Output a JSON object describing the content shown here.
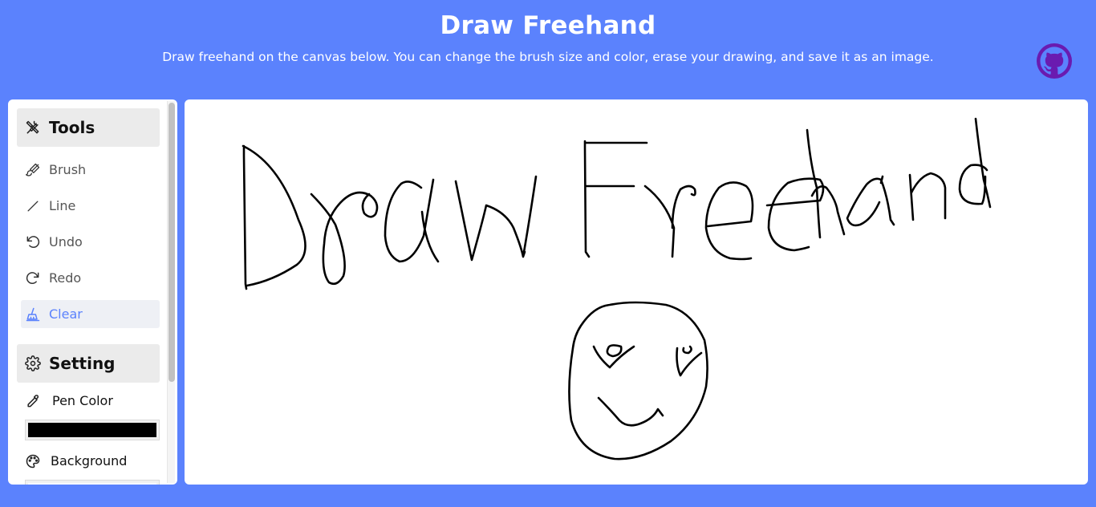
{
  "header": {
    "title": "Draw Freehand",
    "subtitle": "Draw freehand on the canvas below. You can change the brush size and color, erase your drawing, and save it as an image."
  },
  "github": {
    "icon": "github-icon",
    "color": "#6a1bb0"
  },
  "sidebar": {
    "tools_section": {
      "label": "Tools",
      "icon": "tools-icon"
    },
    "tools": [
      {
        "label": "Brush",
        "icon": "brush-icon",
        "active": false
      },
      {
        "label": "Line",
        "icon": "line-icon",
        "active": false
      },
      {
        "label": "Undo",
        "icon": "undo-icon",
        "active": false
      },
      {
        "label": "Redo",
        "icon": "redo-icon",
        "active": false
      },
      {
        "label": "Clear",
        "icon": "clear-icon",
        "active": true
      }
    ],
    "settings_section": {
      "label": "Setting",
      "icon": "gear-icon"
    },
    "settings": {
      "pen_color": {
        "label": "Pen Color",
        "icon": "eyedropper-icon",
        "value": "#000000"
      },
      "background": {
        "label": "Background",
        "icon": "palette-icon"
      }
    }
  },
  "colors": {
    "page_background": "#5b82fd",
    "accent": "#5b82fd",
    "ink": "#000000"
  }
}
